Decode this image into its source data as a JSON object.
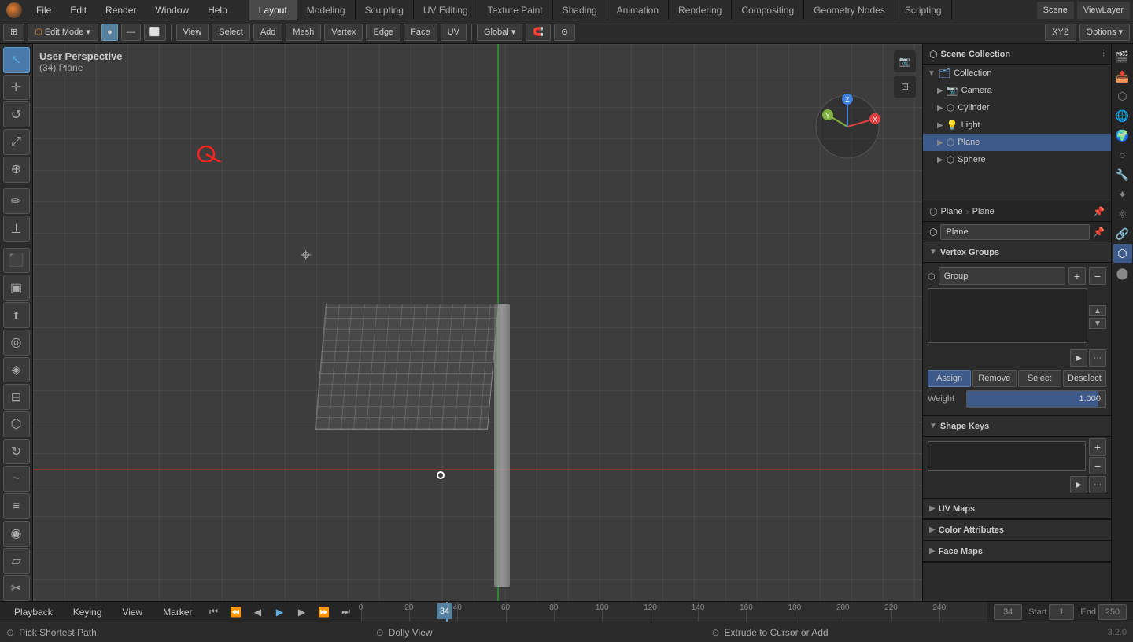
{
  "app": {
    "title": "Blender"
  },
  "top_menu": {
    "items": [
      "File",
      "Edit",
      "Render",
      "Window",
      "Help"
    ]
  },
  "workspace_tabs": [
    {
      "label": "Layout",
      "active": true
    },
    {
      "label": "Modeling",
      "active": false
    },
    {
      "label": "Sculpting",
      "active": false
    },
    {
      "label": "UV Editing",
      "active": false
    },
    {
      "label": "Texture Paint",
      "active": false
    },
    {
      "label": "Shading",
      "active": false
    },
    {
      "label": "Animation",
      "active": false
    },
    {
      "label": "Rendering",
      "active": false
    },
    {
      "label": "Compositing",
      "active": false
    },
    {
      "label": "Geometry Nodes",
      "active": false
    },
    {
      "label": "Scripting",
      "active": false
    }
  ],
  "scene_name": "Scene",
  "view_layer": "ViewLayer",
  "toolbar": {
    "mode_label": "Edit Mode",
    "view_label": "View",
    "select_label": "Select",
    "add_label": "Add",
    "mesh_label": "Mesh",
    "vertex_label": "Vertex",
    "edge_label": "Edge",
    "face_label": "Face",
    "uv_label": "UV",
    "global_label": "Global",
    "options_label": "Options",
    "xyz_label": "XYZ"
  },
  "viewport": {
    "mode": "User Perspective",
    "object_info": "(34) Plane",
    "version": "3.2.0"
  },
  "outliner": {
    "title": "Scene Collection",
    "items": [
      {
        "name": "Collection",
        "type": "collection",
        "indent": 0
      },
      {
        "name": "Camera",
        "type": "camera",
        "indent": 1
      },
      {
        "name": "Cylinder",
        "type": "mesh",
        "indent": 1
      },
      {
        "name": "Light",
        "type": "light",
        "indent": 1
      },
      {
        "name": "Plane",
        "type": "mesh",
        "indent": 1,
        "active": true
      },
      {
        "name": "Sphere",
        "type": "mesh",
        "indent": 1
      }
    ]
  },
  "properties": {
    "breadcrumb_root": "Plane",
    "breadcrumb_child": "Plane",
    "object_name": "Plane",
    "sections": {
      "vertex_groups": {
        "label": "Vertex Groups",
        "group_name": "Group",
        "list_items": [],
        "weight_label": "Weight",
        "weight_value": "1.000",
        "buttons": {
          "assign": "Assign",
          "remove": "Remove",
          "select": "Select",
          "deselect": "Deselect"
        }
      },
      "shape_keys": {
        "label": "Shape Keys"
      },
      "uv_maps": {
        "label": "UV Maps"
      },
      "color_attributes": {
        "label": "Color Attributes"
      },
      "face_maps": {
        "label": "Face Maps"
      }
    }
  },
  "timeline": {
    "playback_label": "Playback",
    "keying_label": "Keying",
    "view_label": "View",
    "marker_label": "Marker",
    "current_frame": "34",
    "start_frame": "1",
    "end_frame": "250",
    "start_label": "Start",
    "end_label": "End",
    "frame_ticks": [
      "0",
      "20",
      "40",
      "60",
      "80",
      "100",
      "120",
      "140",
      "160",
      "180",
      "200",
      "220",
      "240"
    ]
  },
  "status_bar": {
    "left_mode": "Pick Shortest Path",
    "center_mode": "Dolly View",
    "right_mode": "Extrude to Cursor or Add"
  },
  "icons": {
    "expand": "▶",
    "collapse": "▼",
    "plus": "+",
    "minus": "−",
    "arrow_up": "▲",
    "arrow_down": "▼",
    "object": "●",
    "camera": "📷",
    "light": "💡",
    "mesh": "⬡",
    "collection": "🗂",
    "search": "🔍",
    "pin": "📌",
    "filter": "⫶",
    "chevron_left": "◀",
    "chevron_right": "▶"
  }
}
